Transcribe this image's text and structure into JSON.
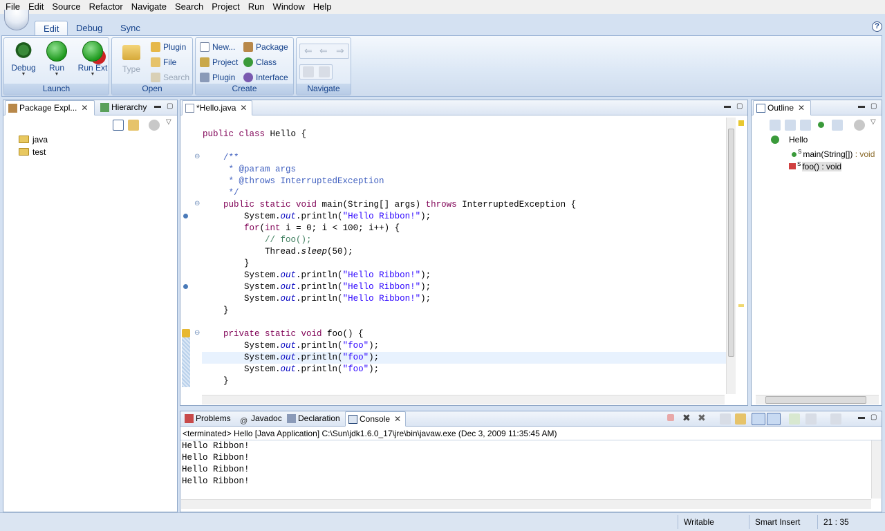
{
  "menu": [
    "File",
    "Edit",
    "Source",
    "Refactor",
    "Navigate",
    "Search",
    "Project",
    "Run",
    "Window",
    "Help"
  ],
  "ribbon_tabs": [
    "Edit",
    "Debug",
    "Sync"
  ],
  "help_label": "?",
  "launch": {
    "label": "Launch",
    "debug": "Debug",
    "run": "Run",
    "run_ext": "Run Ext"
  },
  "open": {
    "label": "Open",
    "type": "Type",
    "plugin": "Plugin",
    "file": "File",
    "search": "Search"
  },
  "create": {
    "label": "Create",
    "new": "New...",
    "project": "Project",
    "plugin": "Plugin",
    "package": "Package",
    "class": "Class",
    "interface": "Interface"
  },
  "navigate": {
    "label": "Navigate"
  },
  "left_views": {
    "package_explorer": "Package Expl...",
    "hierarchy": "Hierarchy"
  },
  "package_tree": [
    "java",
    "test"
  ],
  "editor": {
    "tab": "*Hello.java"
  },
  "outline": {
    "tab": "Outline",
    "class": "Hello",
    "main_name": "main(String[])",
    "main_type": " : void",
    "foo_name": "foo()",
    "foo_type": " : void",
    "static_marker": "S"
  },
  "bottom_tabs": {
    "problems": "Problems",
    "javadoc": "Javadoc",
    "declaration": "Declaration",
    "console": "Console"
  },
  "console": {
    "header": "<terminated> Hello [Java Application] C:\\Sun\\jdk1.6.0_17\\jre\\bin\\javaw.exe (Dec 3, 2009 11:35:45 AM)",
    "lines": [
      "Hello Ribbon!",
      "Hello Ribbon!",
      "Hello Ribbon!",
      "Hello Ribbon!"
    ]
  },
  "status": {
    "mode": "Writable",
    "insert": "Smart Insert",
    "position": "21 : 35"
  },
  "icons": [
    "bug-icon",
    "run-icon",
    "run-ext-icon",
    "open-type-icon",
    "plugin-icon",
    "file-icon",
    "search-icon",
    "new-icon",
    "project-icon",
    "package-icon",
    "class-icon",
    "interface-icon",
    "back-icon",
    "forward-icon",
    "collapse-all-icon",
    "link-editor-icon",
    "close-icon",
    "minimize-icon",
    "maximize-icon",
    "folder-icon",
    "java-file-icon",
    "class-outline-icon",
    "method-icon",
    "console-icon",
    "warning-icon",
    "terminate-icon",
    "remove-icon",
    "pin-icon"
  ],
  "colors": {
    "keyword": "#7f0055",
    "string": "#2a00ff",
    "javadoc": "#3f5fbf",
    "comment": "#3f7f5f",
    "field": "#0000c0",
    "ribbon_text": "#15428b",
    "current_line": "#e8f2fe"
  }
}
